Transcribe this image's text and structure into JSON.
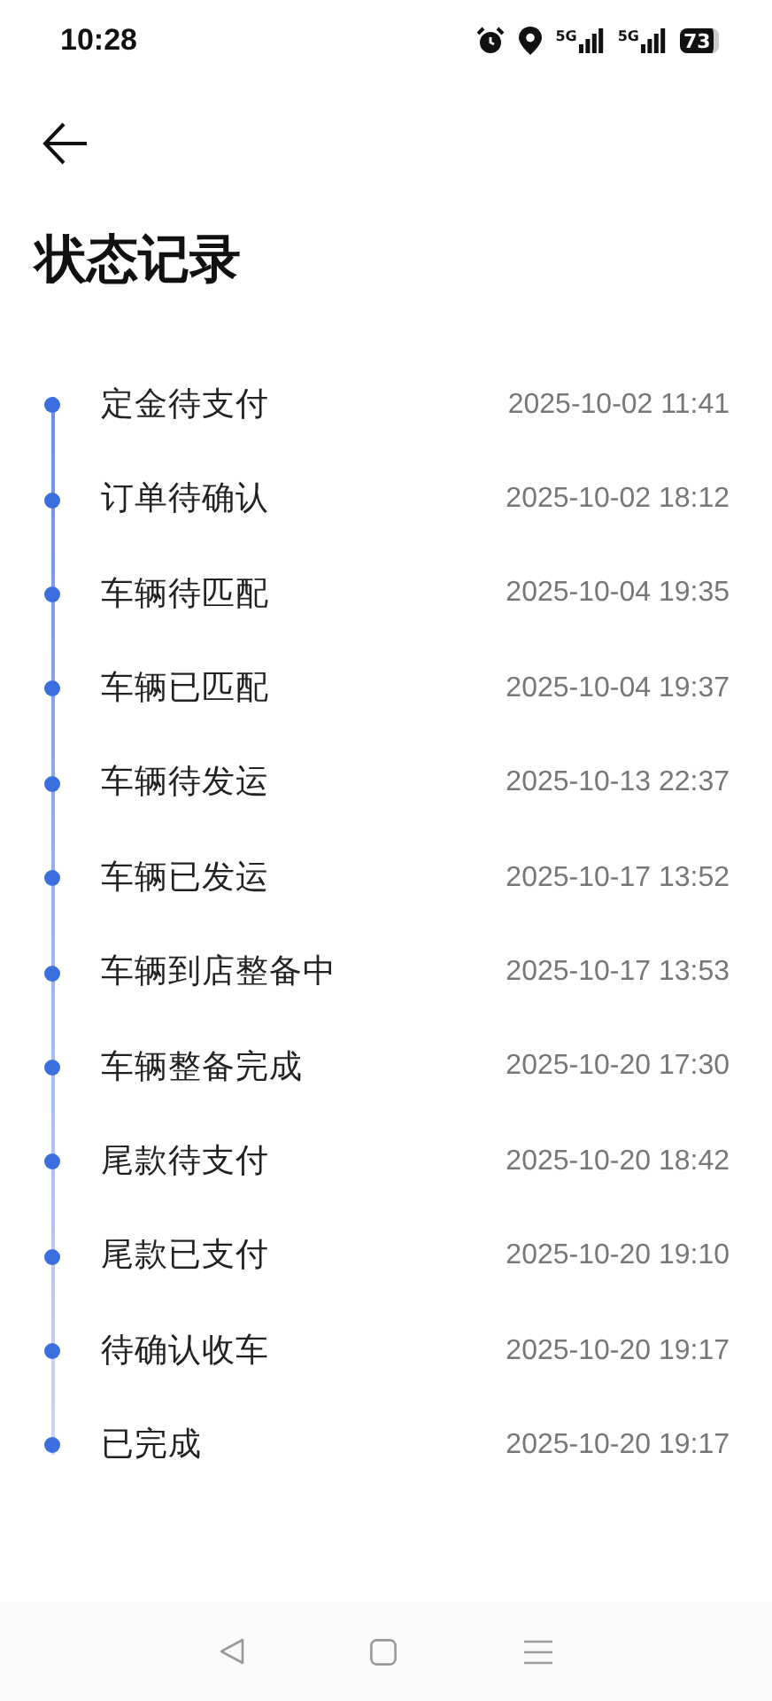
{
  "status_bar": {
    "time": "10:28",
    "networks": [
      "5G",
      "5G"
    ],
    "battery": "73"
  },
  "title": "状态记录",
  "records": [
    {
      "status": "定金待支付",
      "time": "2025-10-02 11:41"
    },
    {
      "status": "订单待确认",
      "time": "2025-10-02 18:12"
    },
    {
      "status": "车辆待匹配",
      "time": "2025-10-04 19:35"
    },
    {
      "status": "车辆已匹配",
      "time": "2025-10-04 19:37"
    },
    {
      "status": "车辆待发运",
      "time": "2025-10-13 22:37"
    },
    {
      "status": "车辆已发运",
      "time": "2025-10-17 13:52"
    },
    {
      "status": "车辆到店整备中",
      "time": "2025-10-17 13:53"
    },
    {
      "status": "车辆整备完成",
      "time": "2025-10-20 17:30"
    },
    {
      "status": "尾款待支付",
      "time": "2025-10-20 18:42"
    },
    {
      "status": "尾款已支付",
      "time": "2025-10-20 19:10"
    },
    {
      "status": "待确认收车",
      "time": "2025-10-20 19:17"
    },
    {
      "status": "已完成",
      "time": "2025-10-20 19:17"
    }
  ]
}
